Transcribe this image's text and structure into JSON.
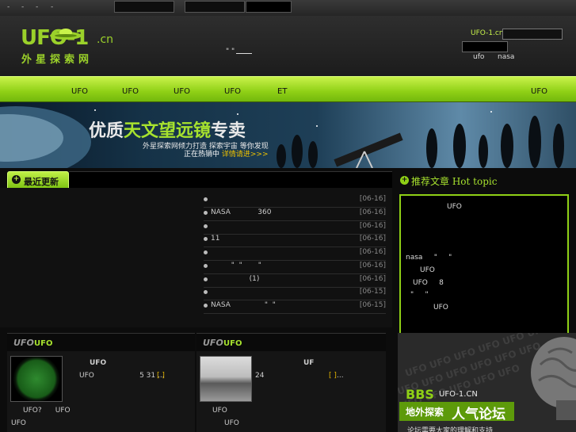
{
  "topbar": {
    "dots": [
      "-",
      "-",
      "-",
      "-"
    ]
  },
  "logo": {
    "name": "UFO-1",
    "tld": ".cn",
    "subtitle": "外星探索网"
  },
  "header": {
    "quote": "\" \"",
    "site_label": "UFO-1.cn",
    "links": [
      "ufo",
      "nasa"
    ]
  },
  "nav": {
    "items": [
      "UFO",
      "UFO",
      "UFO",
      "UFO",
      "ET",
      "UFO"
    ]
  },
  "banner": {
    "title_a": "优质",
    "title_b": "天文望远镜",
    "title_c": "专卖",
    "sub1": "外星探索网倾力打造  探索宇宙  等你发现",
    "sub2_a": "正在热销中",
    "sub2_b": "详情请进>>>"
  },
  "latest": {
    "label": "最近更新",
    "rows": [
      {
        "title": "",
        "date": "[06-16]"
      },
      {
        "title": "NASA            360",
        "date": "[06-16]"
      },
      {
        "title": "",
        "date": "[06-16]"
      },
      {
        "title": "11",
        "date": "[06-16]"
      },
      {
        "title": "",
        "date": "[06-16]"
      },
      {
        "title": "         \"  \"       \"",
        "date": "[06-16]"
      },
      {
        "title": "                 (1)",
        "date": "[06-16]"
      },
      {
        "title": "",
        "date": "[06-15]"
      },
      {
        "title": "NASA               \"  \"",
        "date": "[06-15]"
      }
    ]
  },
  "hot": {
    "title": "推荐文章 Hot topic",
    "items": [
      "UFO",
      "nasa     \"     \"",
      "UFO",
      "UFO     8",
      "\"     \"",
      "UFO"
    ]
  },
  "sections": [
    {
      "logo": "UFO",
      "title": "UFO",
      "heading": "UFO",
      "line": "UFO                    5 31 ...",
      "more": "[ ]",
      "foot1": "UFO?      UFO",
      "foot2": "UFO"
    },
    {
      "logo": "UFO",
      "title": "UFO",
      "heading": "UF",
      "line": "24                                ...",
      "more": "[ ]",
      "foot1": "UFO",
      "foot2": "UFO"
    }
  ],
  "bbs": {
    "bbs": "BBS",
    "site": "UFO-1.CN",
    "line_a": "地外探索",
    "line_b": "人气论坛",
    "line_c": "论坛需要大家的理解和支持"
  },
  "colors": {
    "accent": "#8fd016",
    "accent_light": "#c9f24a",
    "date": "#888888",
    "link_more": "#e3b400"
  },
  "icons": [
    "circle-plus-icon",
    "ufo-saucer-icon",
    "telescope-icon",
    "brain-icon"
  ]
}
